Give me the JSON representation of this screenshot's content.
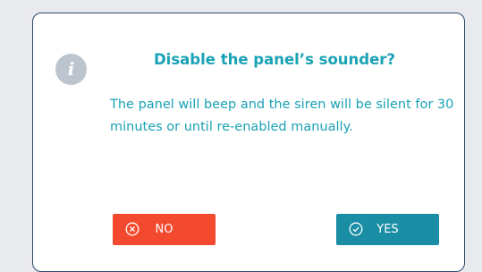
{
  "dialog": {
    "title": "Disable the panel’s sounder?",
    "message": "The panel will beep and the siren will be silent for 30 minutes or until re-enabled manually.",
    "info_icon_glyph": "i",
    "icons": {
      "info": "info-icon",
      "no": "close-circle-icon",
      "yes": "check-circle-icon"
    },
    "buttons": {
      "no_label": "NO",
      "yes_label": "YES"
    }
  },
  "colors": {
    "accent": "#1aa2b6",
    "no_button": "#f2492f",
    "yes_button": "#1a8ea4",
    "border": "#2c4a6a",
    "background": "#e9eaee"
  }
}
